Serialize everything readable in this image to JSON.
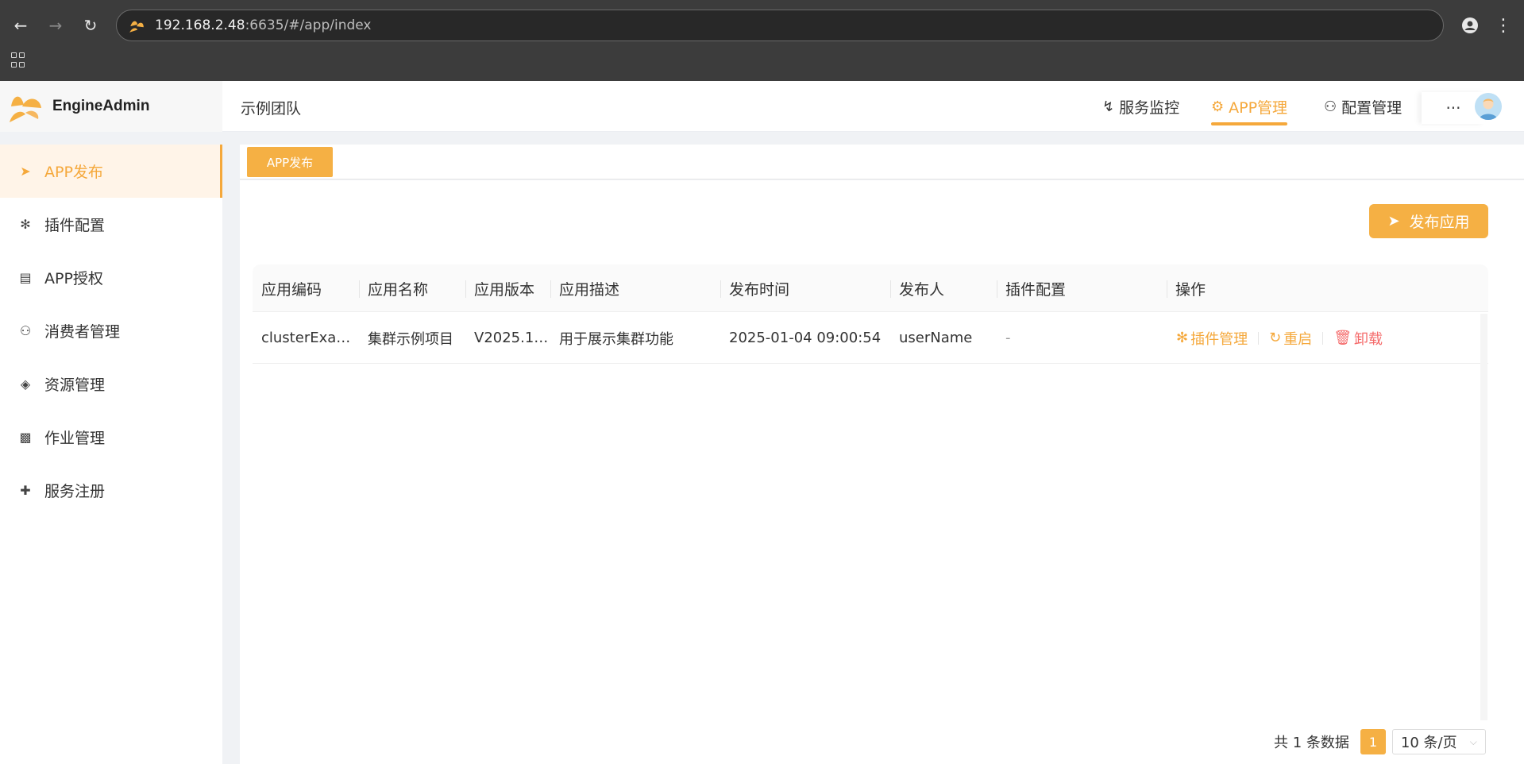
{
  "browser": {
    "url_host": "192.168.2.48",
    "url_rest": ":6635/#/app/index",
    "icons": [
      "back-icon",
      "forward-icon",
      "reload-icon",
      "site-logo-icon",
      "profile-icon",
      "menu-icon",
      "apps-icon"
    ]
  },
  "app": {
    "title": "EngineAdmin",
    "team": "示例团队",
    "accent_color": "#f5a83b"
  },
  "topnav": {
    "items": [
      {
        "label": "服务监控",
        "icon": "monitor-icon"
      },
      {
        "label": "APP管理",
        "icon": "gear-icon",
        "active": true
      },
      {
        "label": "配置管理",
        "icon": "config-icon"
      }
    ],
    "more": "···"
  },
  "sidebar": {
    "items": [
      {
        "label": "APP发布",
        "icon": "send-icon",
        "active": true
      },
      {
        "label": "插件配置",
        "icon": "plugin-icon"
      },
      {
        "label": "APP授权",
        "icon": "license-icon"
      },
      {
        "label": "消费者管理",
        "icon": "users-icon"
      },
      {
        "label": "资源管理",
        "icon": "layers-icon"
      },
      {
        "label": "作业管理",
        "icon": "job-icon"
      },
      {
        "label": "服务注册",
        "icon": "user-add-icon"
      }
    ]
  },
  "tabs": [
    {
      "label": "APP发布"
    }
  ],
  "toolbar": {
    "publish_label": "发布应用"
  },
  "table": {
    "columns": [
      "应用编码",
      "应用名称",
      "应用版本",
      "应用描述",
      "发布时间",
      "发布人",
      "插件配置",
      "操作"
    ],
    "rows": [
      {
        "code": "clusterExam...",
        "name": "集群示例项目",
        "version": "V2025.1....",
        "desc": "用于展示集群功能",
        "time": "2025-01-04 09:00:54",
        "publisher": "userName",
        "plugin": "-",
        "actions": {
          "plugin_manage": "插件管理",
          "restart": "重启",
          "uninstall": "卸载"
        }
      }
    ]
  },
  "pagination": {
    "total": "共 1 条数据",
    "current": "1",
    "page_size": "10 条/页"
  }
}
